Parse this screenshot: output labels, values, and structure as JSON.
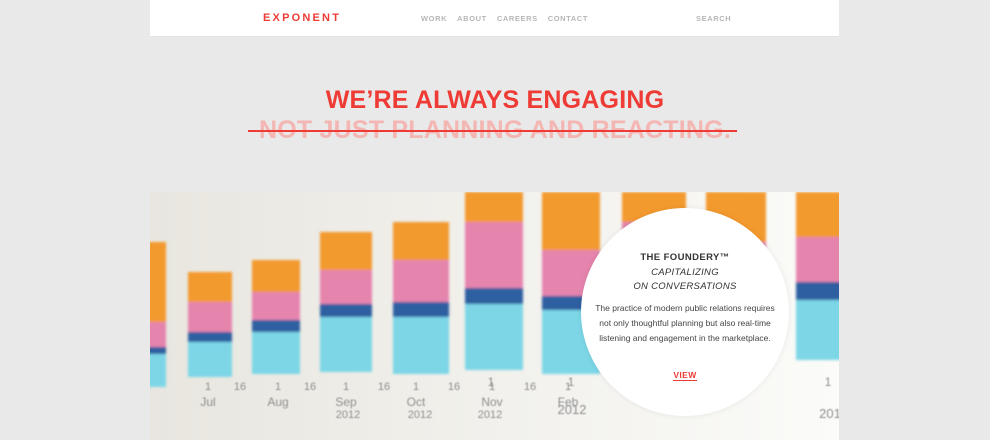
{
  "header": {
    "logo": "EXPONENT",
    "nav": [
      "WORK",
      "ABOUT",
      "CAREERS",
      "CONTACT"
    ],
    "search": "SEARCH"
  },
  "hero_text": {
    "headline": "WE’RE ALWAYS ENGAGING",
    "subhead": "NOT JUST PLANNING AND REACTING."
  },
  "feature": {
    "title": "THE FOUNDERY™",
    "subtitle_line1": "CAPITALIZING",
    "subtitle_line2": "ON CONVERSATIONS",
    "body": "The practice of modern public relations requires not only thoughtful planning but also real-time listening and engagement in the marketplace.",
    "link": "VIEW"
  },
  "photo": {
    "axis_labels": [
      {
        "num": "",
        "sub": ""
      },
      {
        "num": "1",
        "sub": "Jul"
      },
      {
        "num": "16",
        "sub": ""
      },
      {
        "num": "1",
        "sub": "Aug"
      },
      {
        "num": "16",
        "sub": ""
      },
      {
        "num": "1",
        "sub": "Sep"
      },
      {
        "num": "16",
        "sub": ""
      },
      {
        "num": "1",
        "sub": "Oct"
      },
      {
        "num": "16",
        "sub": ""
      },
      {
        "num": "1",
        "sub": "Nov"
      },
      {
        "num": "16",
        "sub": ""
      },
      {
        "num": "1",
        "sub": "Feb"
      }
    ],
    "years": [
      "2012",
      "2012",
      "2012",
      "2012",
      "201"
    ]
  }
}
